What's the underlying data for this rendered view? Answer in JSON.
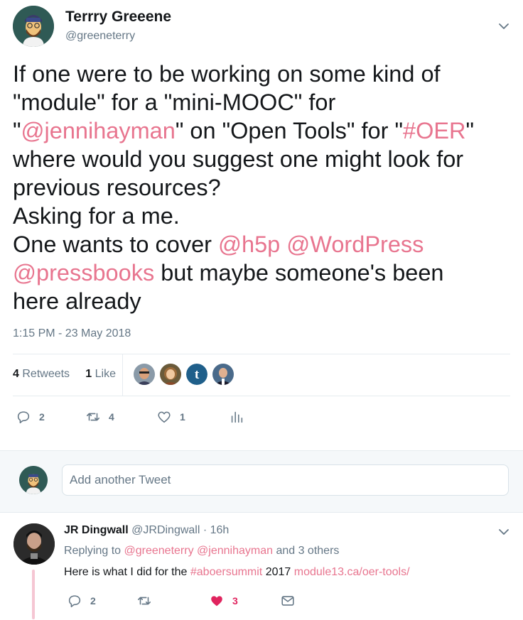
{
  "tweet": {
    "author_name": "Terrry Greeene",
    "author_handle": "@greeneterry",
    "text_lines": [
      [
        {
          "t": "If one were to be working on some kind of"
        }
      ],
      [
        {
          "t": "\"module\" for a \"mini-MOOC\" for"
        }
      ],
      [
        {
          "t": "\""
        },
        {
          "t": "@jennihayman",
          "m": true
        },
        {
          "t": "\" on \"Open Tools\" for \""
        },
        {
          "t": "#OER",
          "m": true
        },
        {
          "t": "\""
        }
      ],
      [
        {
          "t": "where would you suggest one might look for"
        }
      ],
      [
        {
          "t": "previous resources?"
        }
      ],
      [
        {
          "t": "Asking for a me."
        }
      ],
      [
        {
          "t": "One wants to cover "
        },
        {
          "t": "@h5p",
          "m": true
        },
        {
          "t": " "
        },
        {
          "t": "@WordPress",
          "m": true
        }
      ],
      [
        {
          "t": "@pressbooks",
          "m": true
        },
        {
          "t": " but maybe someone's been"
        }
      ],
      [
        {
          "t": "here already"
        }
      ]
    ],
    "timestamp": "1:15 PM - 23 May 2018",
    "retweets_count": "4",
    "retweets_label": "Retweets",
    "likes_count": "1",
    "likes_label": "Like",
    "actions": {
      "reply": "2",
      "retweet": "4",
      "like": "1"
    }
  },
  "composer": {
    "placeholder": "Add another Tweet"
  },
  "reply": {
    "author_name": "JR Dingwall",
    "author_handle": "@JRDingwall",
    "age": "· 16h",
    "replying_prefix": "Replying to",
    "replying_to_1": "@greeneterry",
    "replying_to_2": "@jennihayman",
    "replying_suffix": "and 3 others",
    "text_before": "Here is what I did for the",
    "hashtag": "#aboersummit",
    "text_middle": "2017",
    "link": "module13.ca/oer-tools/",
    "actions": {
      "reply": "2",
      "like": "3"
    }
  },
  "colors": {
    "mention": "#e8758f",
    "like_active": "#e0245e",
    "muted": "#657786"
  }
}
